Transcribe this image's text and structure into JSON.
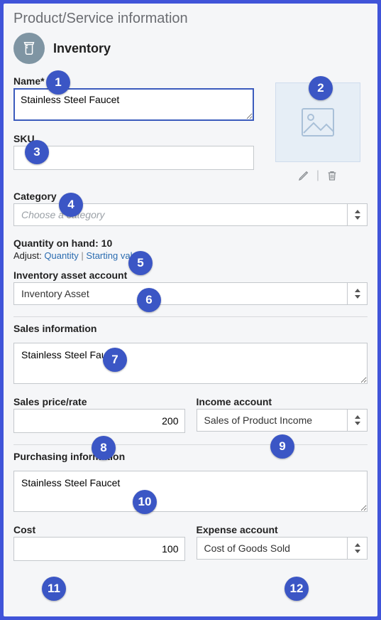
{
  "title": "Product/Service information",
  "type_label": "Inventory",
  "name": {
    "label": "Name*",
    "value": "Stainless Steel Faucet"
  },
  "sku": {
    "label": "SKU",
    "value": ""
  },
  "category": {
    "label": "Category",
    "placeholder": "Choose a category"
  },
  "quantity": {
    "label": "Quantity on hand:",
    "value": "10",
    "adjust_label": "Adjust:",
    "link_quantity": "Quantity",
    "link_starting": "Starting value"
  },
  "asset_account": {
    "label": "Inventory asset account",
    "value": "Inventory Asset"
  },
  "sales": {
    "section_label": "Sales information",
    "description": "Stainless Steel Faucet",
    "price_label": "Sales price/rate",
    "price_value": "200",
    "income_label": "Income account",
    "income_value": "Sales of Product Income"
  },
  "purchasing": {
    "section_label": "Purchasing information",
    "description": "Stainless Steel Faucet",
    "cost_label": "Cost",
    "cost_value": "100",
    "expense_label": "Expense account",
    "expense_value": "Cost of Goods Sold"
  },
  "badges": {
    "b1": "1",
    "b2": "2",
    "b3": "3",
    "b4": "4",
    "b5": "5",
    "b6": "6",
    "b7": "7",
    "b8": "8",
    "b9": "9",
    "b10": "10",
    "b11": "11",
    "b12": "12"
  }
}
